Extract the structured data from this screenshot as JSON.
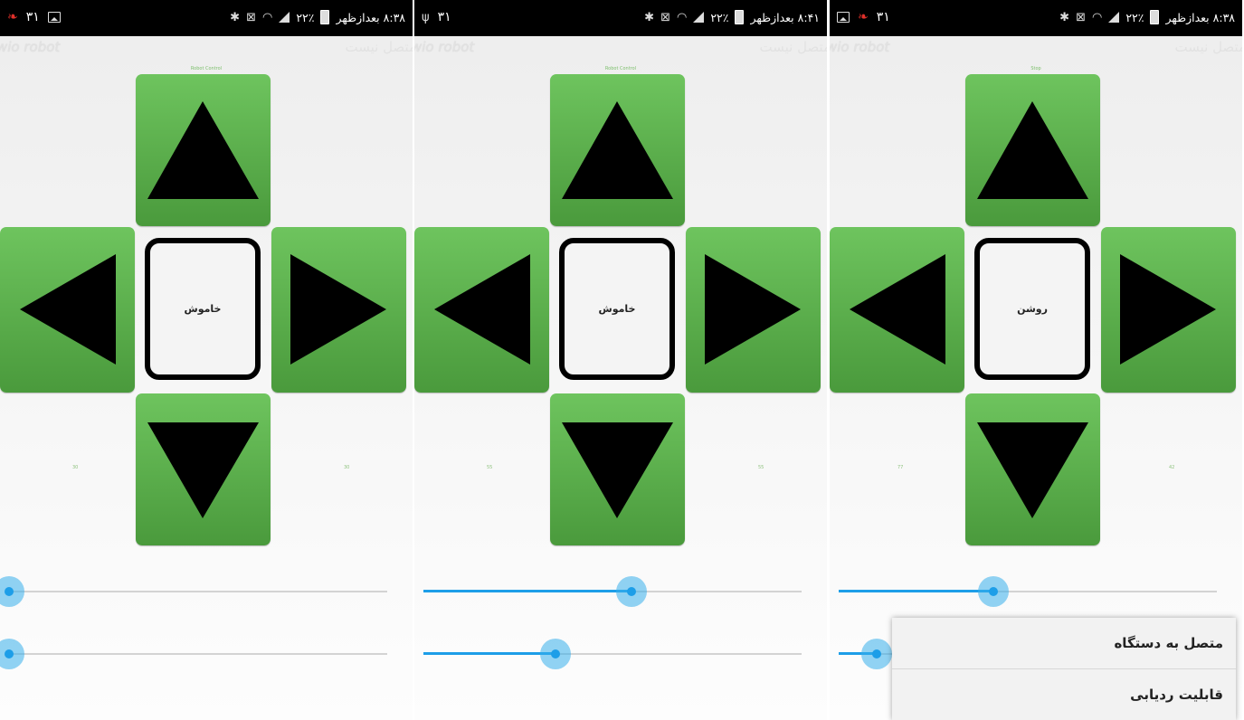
{
  "panels": [
    {
      "status_time": "۸:۳۸ بعدازظهر",
      "status_battery": "۲۲٪",
      "status_left_num": "۳۱",
      "app_title": "wio robot",
      "connection_status": "متصل نیست",
      "top_label": "Robot Control",
      "center_label": "خاموش",
      "left_value": "30",
      "right_value": "30",
      "slider1": 0.0,
      "slider2": 0.0
    },
    {
      "status_time": "۸:۴۱ بعدازظهر",
      "status_battery": "۲۲٪",
      "status_left_num": "۳۱",
      "app_title": "wio robot",
      "connection_status": "متصل نیست",
      "top_label": "Robot Control",
      "center_label": "خاموش",
      "left_value": "55",
      "right_value": "55",
      "slider1": 0.55,
      "slider2": 0.35
    },
    {
      "status_time": "۸:۳۸ بعدازظهر",
      "status_battery": "۲۲٪",
      "status_left_num": "۳۱",
      "app_title": "wio robot",
      "connection_status": "متصل نیست",
      "top_label": "Stop",
      "center_label": "روشن",
      "left_value": "77",
      "right_value": "42",
      "slider1": 0.41,
      "slider2": 0.1,
      "menu": [
        {
          "label": "متصل به دستگاه"
        },
        {
          "label": "قابلیت ردیابی"
        }
      ]
    }
  ],
  "colors": {
    "button_green_top": "#6ec45e",
    "button_green_bottom": "#4a9a3c",
    "slider_blue": "#1d9ee8",
    "statusbar": "#000000"
  },
  "icons": {
    "up": "arrow-up-icon",
    "down": "arrow-down-icon",
    "left": "arrow-left-icon",
    "right": "arrow-right-icon"
  }
}
